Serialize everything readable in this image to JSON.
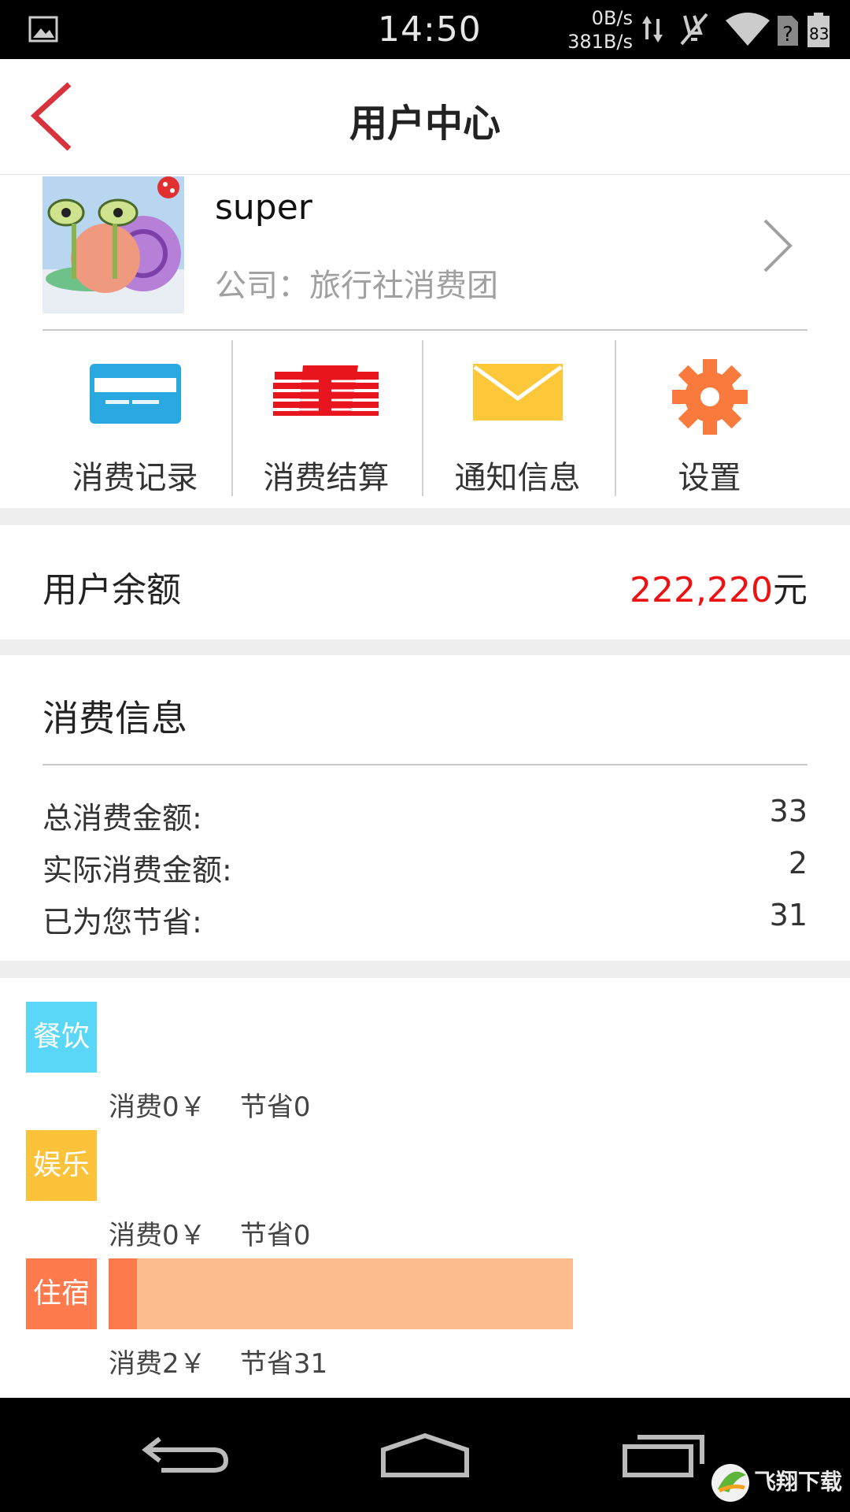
{
  "status_bar": {
    "time": "14:50",
    "net_down": "0B/s",
    "net_up": "381B/s",
    "battery": "83"
  },
  "header": {
    "title": "用户中心"
  },
  "profile": {
    "username": "super",
    "company": "公司：旅行社消费团"
  },
  "actions": [
    {
      "label": "消费记录",
      "icon": "credit-card-icon",
      "color": "#2aa8e0"
    },
    {
      "label": "消费结算",
      "icon": "money-stack-icon",
      "color": "#e8141e"
    },
    {
      "label": "通知信息",
      "icon": "envelope-icon",
      "color": "#fcc83a"
    },
    {
      "label": "设置",
      "icon": "gear-icon",
      "color": "#f97a3c"
    }
  ],
  "balance": {
    "label": "用户余额",
    "amount": "222,220",
    "unit": "元"
  },
  "consumption": {
    "title": "消费信息",
    "rows": [
      {
        "label": "总消费金额:",
        "value": "33"
      },
      {
        "label": "实际消费金额:",
        "value": "2"
      },
      {
        "label": "已为您节省:",
        "value": "31"
      }
    ]
  },
  "categories": [
    {
      "name": "餐饮",
      "color": "#5ad7f7",
      "summary": "消费0￥    节省0",
      "spent": 0,
      "saved": 0
    },
    {
      "name": "娱乐",
      "color": "#fcc23a",
      "summary": "消费0￥    节省0",
      "spent": 0,
      "saved": 0
    },
    {
      "name": "住宿",
      "color": "#fd7a4d",
      "summary": "消费2￥    节省31",
      "spent": 2,
      "saved": 31
    }
  ],
  "watermark": "飞翔下载"
}
